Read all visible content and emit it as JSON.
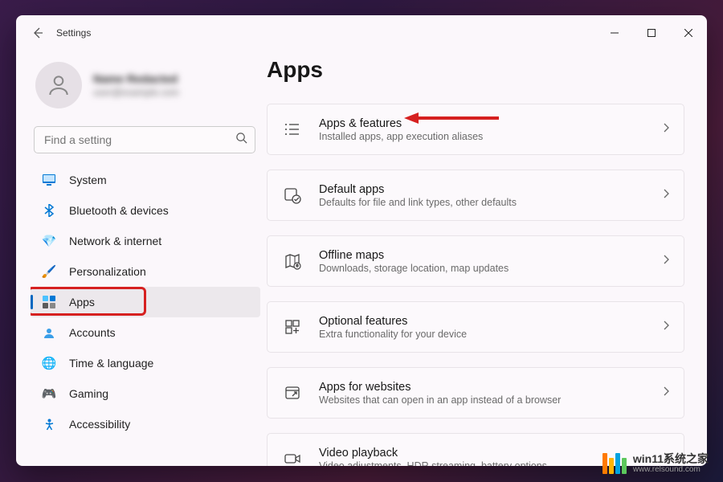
{
  "window": {
    "title": "Settings"
  },
  "profile": {
    "name": "Name Redacted",
    "email": "user@example.com"
  },
  "search": {
    "placeholder": "Find a setting"
  },
  "nav": {
    "items": [
      {
        "key": "system",
        "label": "System",
        "icon": "🖥️"
      },
      {
        "key": "bluetooth",
        "label": "Bluetooth & devices",
        "icon": "bt"
      },
      {
        "key": "network",
        "label": "Network & internet",
        "icon": "🔷"
      },
      {
        "key": "personalization",
        "label": "Personalization",
        "icon": "🖌️"
      },
      {
        "key": "apps",
        "label": "Apps",
        "icon": "apps",
        "selected": true
      },
      {
        "key": "accounts",
        "label": "Accounts",
        "icon": "👤"
      },
      {
        "key": "time",
        "label": "Time & language",
        "icon": "🌐"
      },
      {
        "key": "gaming",
        "label": "Gaming",
        "icon": "🎮"
      },
      {
        "key": "accessibility",
        "label": "Accessibility",
        "icon": "♿"
      }
    ]
  },
  "page": {
    "title": "Apps"
  },
  "cards": [
    {
      "key": "apps-features",
      "title": "Apps & features",
      "sub": "Installed apps, app execution aliases",
      "icon": "list"
    },
    {
      "key": "default-apps",
      "title": "Default apps",
      "sub": "Defaults for file and link types, other defaults",
      "icon": "default"
    },
    {
      "key": "offline-maps",
      "title": "Offline maps",
      "sub": "Downloads, storage location, map updates",
      "icon": "map"
    },
    {
      "key": "optional-features",
      "title": "Optional features",
      "sub": "Extra functionality for your device",
      "icon": "optional"
    },
    {
      "key": "apps-websites",
      "title": "Apps for websites",
      "sub": "Websites that can open in an app instead of a browser",
      "icon": "web"
    },
    {
      "key": "video-playback",
      "title": "Video playback",
      "sub": "Video adjustments, HDR streaming, battery options",
      "icon": "video"
    }
  ],
  "watermark": {
    "text": "win11系统之家",
    "url": "www.relsound.com"
  },
  "colors": {
    "accent": "#0067c0",
    "annotation": "#d62020"
  }
}
